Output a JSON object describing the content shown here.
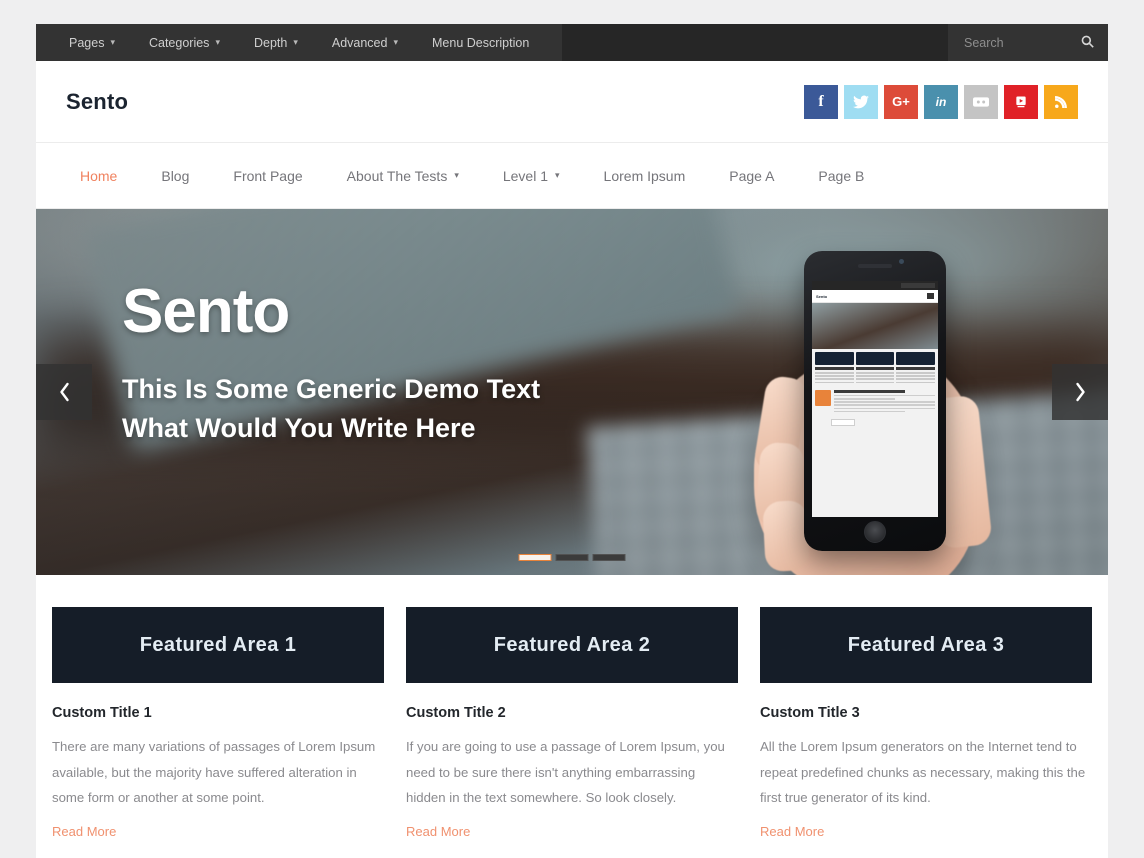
{
  "topbar": {
    "items": [
      {
        "label": "Pages",
        "caret": true
      },
      {
        "label": "Categories",
        "caret": true
      },
      {
        "label": "Depth",
        "caret": true
      },
      {
        "label": "Advanced",
        "caret": true
      },
      {
        "label": "Menu Description",
        "caret": false
      }
    ],
    "search_placeholder": "Search",
    "search_value": "",
    "search_icon": "search-icon"
  },
  "brand": {
    "logo": "Sento",
    "social": [
      {
        "name": "facebook",
        "glyph": "f",
        "color": "#3b5998"
      },
      {
        "name": "twitter",
        "glyph": "t",
        "color": "#9fddf2"
      },
      {
        "name": "googleplus",
        "glyph": "G+",
        "color": "#dd4b39"
      },
      {
        "name": "linkedin",
        "glyph": "in",
        "color": "#4a90ad"
      },
      {
        "name": "flickr",
        "glyph": "••",
        "color": "#c4c4c4"
      },
      {
        "name": "youtube",
        "glyph": "y",
        "color": "#e02127"
      },
      {
        "name": "rss",
        "glyph": "rss",
        "color": "#f7a81b"
      }
    ]
  },
  "mainnav": {
    "items": [
      {
        "label": "Home",
        "active": true,
        "caret": false
      },
      {
        "label": "Blog",
        "active": false,
        "caret": false
      },
      {
        "label": "Front Page",
        "active": false,
        "caret": false
      },
      {
        "label": "About The Tests",
        "active": false,
        "caret": true
      },
      {
        "label": "Level 1",
        "active": false,
        "caret": true
      },
      {
        "label": "Lorem Ipsum",
        "active": false,
        "caret": false
      },
      {
        "label": "Page A",
        "active": false,
        "caret": false
      },
      {
        "label": "Page B",
        "active": false,
        "caret": false
      }
    ]
  },
  "hero": {
    "title": "Sento",
    "subtitle_line1": "This Is Some Generic Demo Text",
    "subtitle_line2": "What Would You Write Here",
    "prev_icon": "chevron-left-icon",
    "next_icon": "chevron-right-icon",
    "slides": 3,
    "active_slide": 1
  },
  "features": [
    {
      "box_label": "Featured Area 1",
      "title": "Custom Title 1",
      "text": "There are many variations of passages of Lorem Ipsum available, but the majority have suffered alteration in some form or another at some point.",
      "link": "Read More"
    },
    {
      "box_label": "Featured Area 2",
      "title": "Custom Title 2",
      "text": "If you are going to use a passage of Lorem Ipsum, you need to be sure there isn't anything embarrassing hidden in the text somewhere. So look closely.",
      "link": "Read More"
    },
    {
      "box_label": "Featured Area 3",
      "title": "Custom Title 3",
      "text": "All the Lorem Ipsum generators on the Internet tend to repeat predefined chunks as necessary, making this the first true generator of its kind.",
      "link": "Read More"
    }
  ],
  "colors": {
    "page_bg": "#efeff0",
    "topbar_bg": "#262626",
    "topbar_menu_bg": "#333333",
    "accent": "#f0825f",
    "featured_box_bg": "#151d28",
    "logo_color": "#1b2430"
  }
}
